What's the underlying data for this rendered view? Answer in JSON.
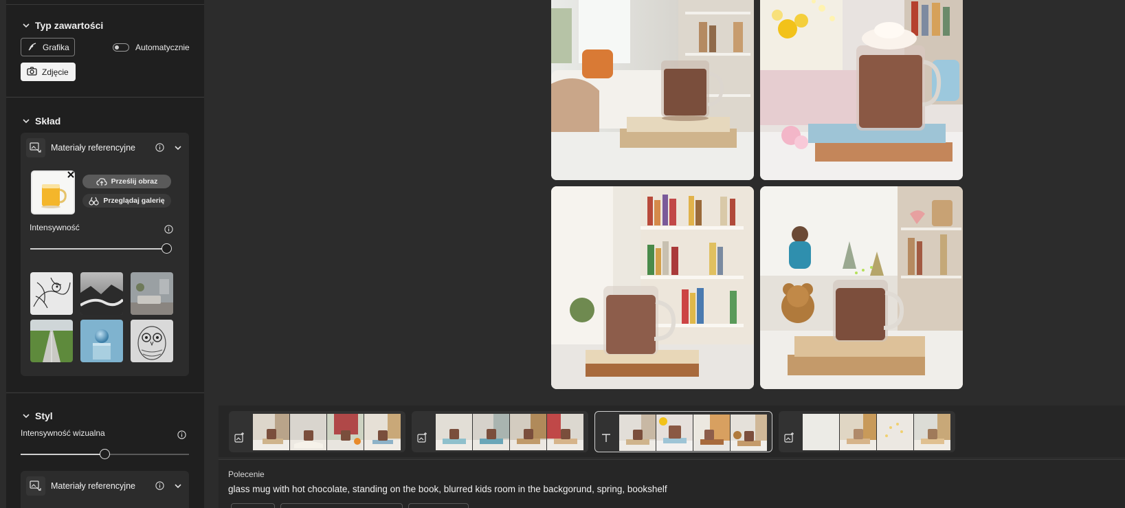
{
  "sidebar": {
    "content_type": {
      "header": "Typ zawartości",
      "graphic_label": "Grafika",
      "auto_label": "Automatycznie",
      "photo_label": "Zdjęcie"
    },
    "composition": {
      "header": "Skład",
      "reference_title": "Materiały referencyjne",
      "upload_label": "Prześlij obraz",
      "browse_label": "Przeglądaj galerię",
      "intensity_label": "Intensywność",
      "intensity_value": 1.0,
      "gallery_thumbs": [
        "line-art-bird",
        "bw-landscape",
        "living-room",
        "green-road",
        "blue-sphere",
        "line-art-owl"
      ]
    },
    "style": {
      "header": "Styl",
      "visual_intensity_label": "Intensywność wizualna",
      "visual_intensity_value": 0.5,
      "reference_title": "Materiały referencyjne"
    }
  },
  "results": [
    "mug-on-books-sofa",
    "mug-whipped-cream-books",
    "mug-on-book-bookshelf",
    "mug-on-books-teddy-child"
  ],
  "history_groups": [
    {
      "icon": "image-generate-icon",
      "active": false,
      "thumbs": 4
    },
    {
      "icon": "image-generate-icon",
      "active": false,
      "thumbs": 4
    },
    {
      "icon": "text-icon",
      "active": true,
      "thumbs": 4
    },
    {
      "icon": "image-generate-icon",
      "active": false,
      "thumbs": 4
    }
  ],
  "prompt": {
    "label": "Polecenie",
    "text": "glass mug with hot chocolate, standing on the book, blurred kids room in the backgorund, spring, bookshelf"
  },
  "colors": {
    "sidebar_bg": "#242424",
    "panel_bg": "#1f1f1f",
    "main_bg": "#2c2c2c",
    "cocoa": "#7a4e3c"
  }
}
